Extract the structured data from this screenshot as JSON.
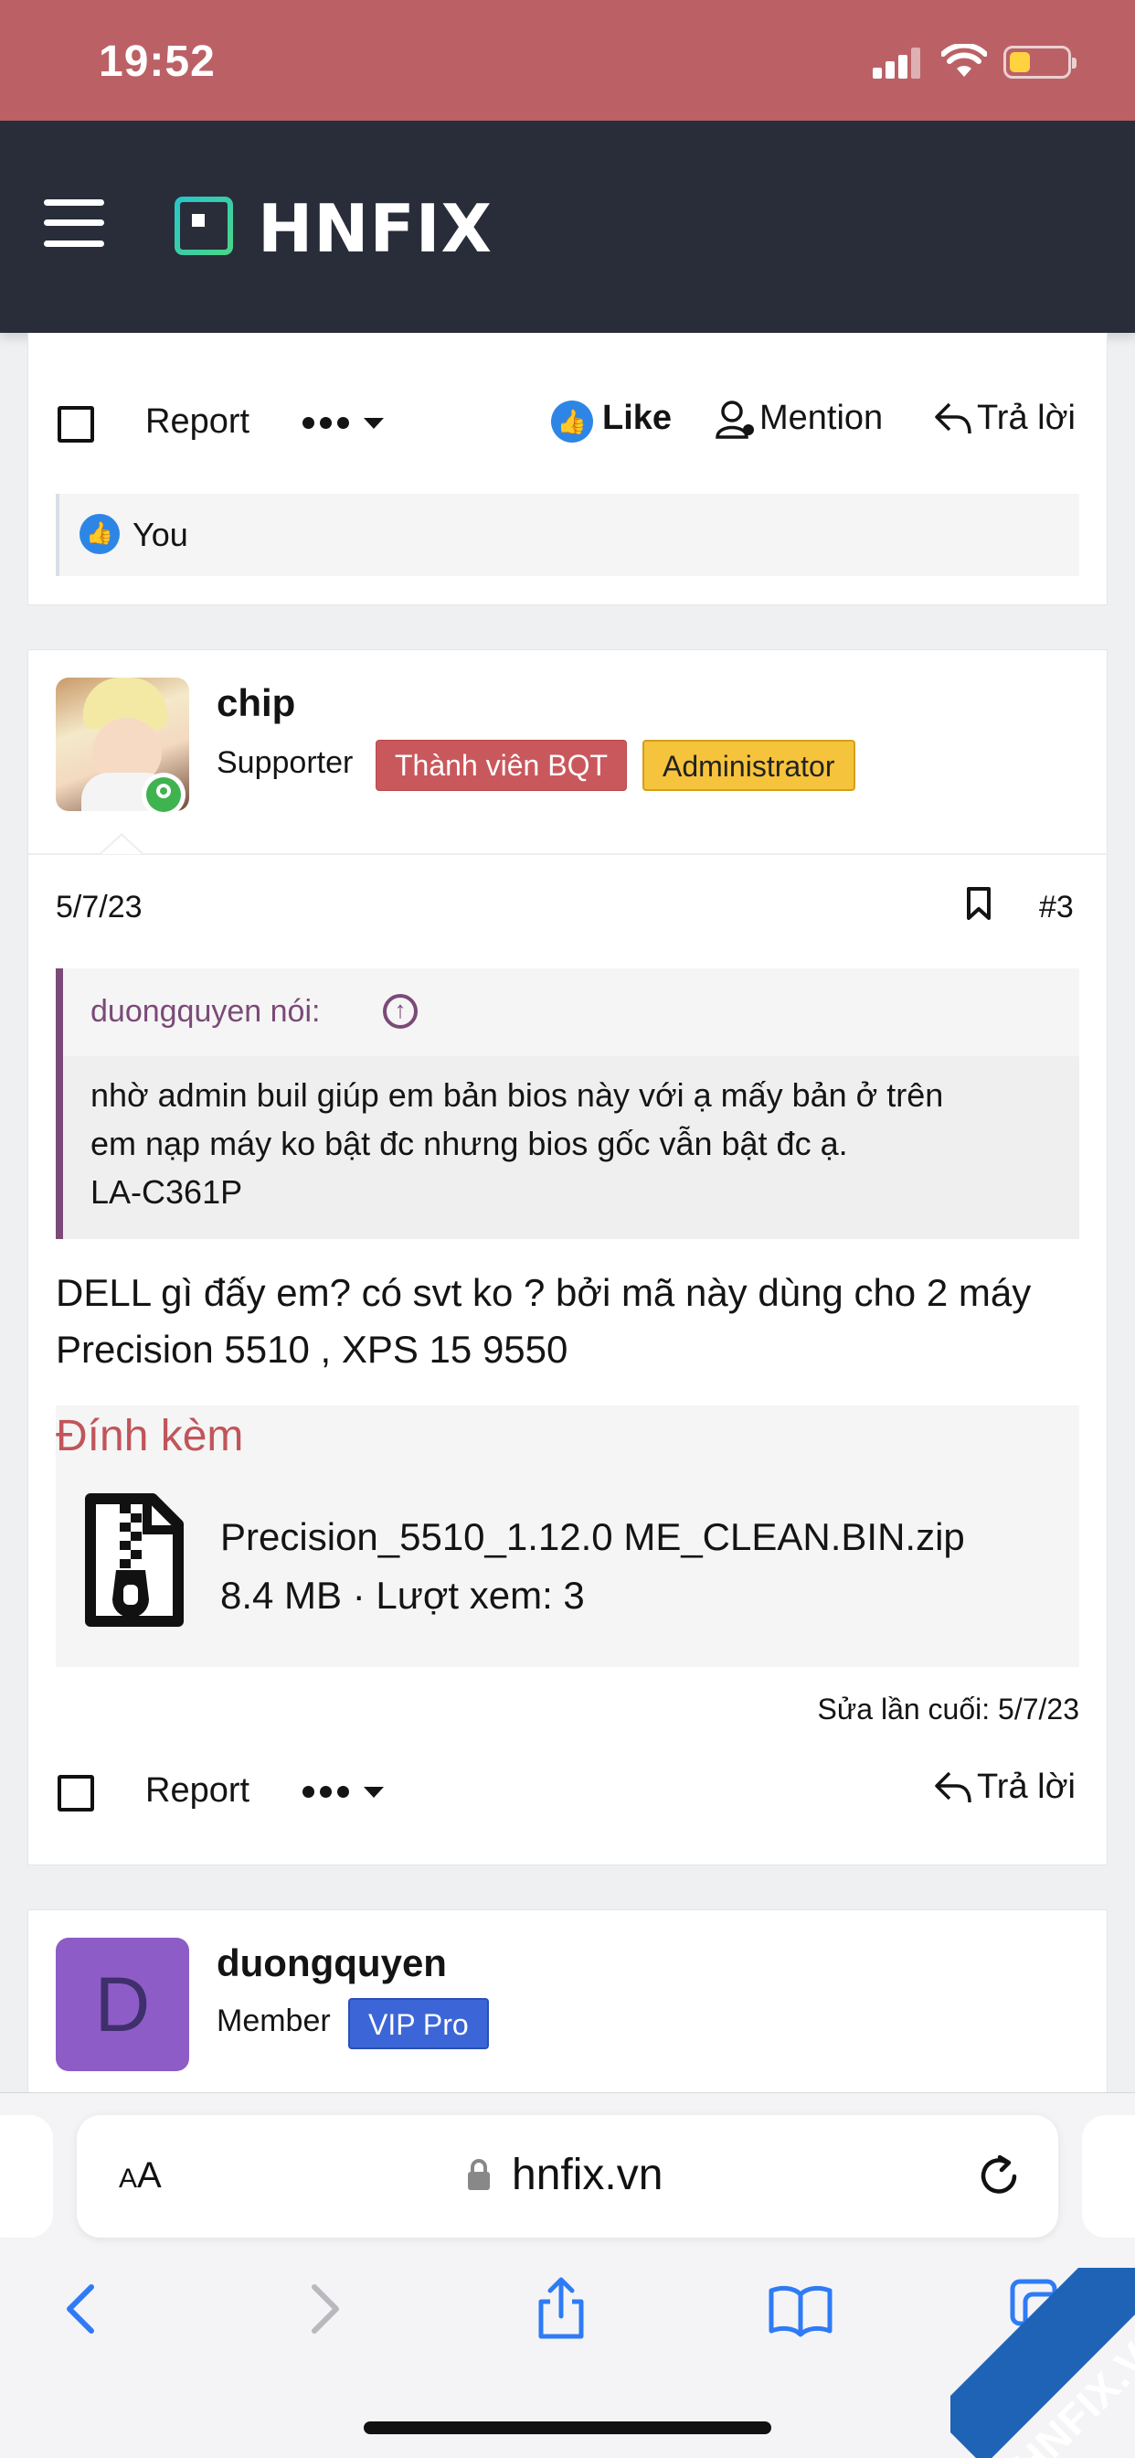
{
  "status_bar": {
    "time": "19:52"
  },
  "header": {
    "logo_text": "HNFIX"
  },
  "colors": {
    "brand_header": "#282d39",
    "status_bar": "#bb6166",
    "like_blue": "#2d86e5",
    "quote_purple": "#7a4a78",
    "attachment_red": "#c0555a"
  },
  "post_prev": {
    "actions": {
      "report": "Report",
      "like": "Like",
      "mention": "Mention",
      "reply": "Trả lời"
    },
    "reaction": "You"
  },
  "post_main": {
    "author": {
      "name": "chip",
      "title": "Supporter",
      "badges": [
        "Thành viên BQT",
        "Administrator"
      ]
    },
    "date": "5/7/23",
    "number": "#3",
    "quote": {
      "author": "duongquyen nói:",
      "lines": [
        "nhờ admin buil giúp em bản bios này với ạ mấy bản ở trên",
        "em nạp máy ko bật đc nhưng bios gốc vẫn bật đc ạ.",
        "LA-C361P"
      ]
    },
    "body_lines": [
      "DELL gì đấy em? có svt ko ? bởi mã này dùng cho 2 máy",
      "Precision 5510 , XPS 15 9550"
    ],
    "attachments_title": "Đính kèm",
    "attachment": {
      "name": "Precision_5510_1.12.0 ME_CLEAN.BIN.zip",
      "meta": "8.4 MB · Lượt xem: 3",
      "icon": "zip-file-icon"
    },
    "last_edit": "Sửa lần cuối: 5/7/23",
    "actions": {
      "report": "Report",
      "reply": "Trả lời"
    }
  },
  "post_next": {
    "author": {
      "initial": "D",
      "name": "duongquyen",
      "title": "Member",
      "badge": "VIP Pro"
    }
  },
  "browser": {
    "aa": "AA",
    "url": "hnfix.vn"
  },
  "watermark": "HNFIX.VN"
}
